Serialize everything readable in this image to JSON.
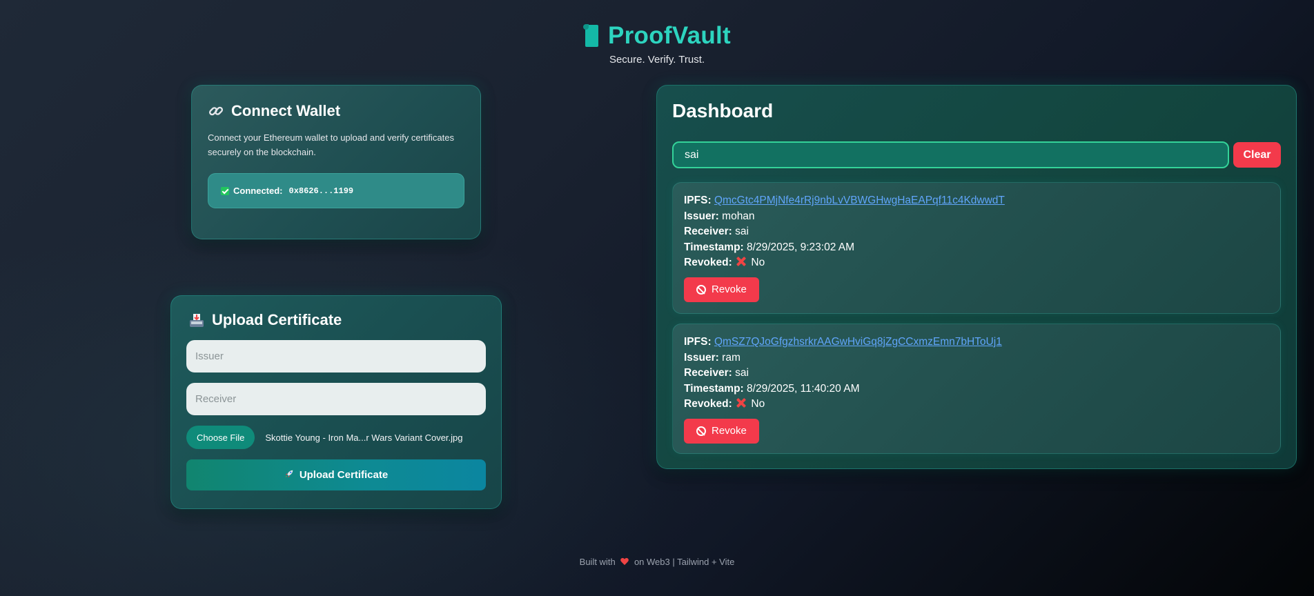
{
  "header": {
    "logo_icon": "scroll-icon",
    "title": "ProofVault",
    "tagline": "Secure. Verify. Trust."
  },
  "wallet": {
    "title_icon": "link-icon",
    "title": "Connect Wallet",
    "description": "Connect your Ethereum wallet to upload and verify certificates securely on the blockchain.",
    "status_icon": "check-icon",
    "connected_label": "Connected:",
    "address": "0x8626...1199"
  },
  "upload": {
    "title_icon": "inbox-tray-icon",
    "title": "Upload Certificate",
    "issuer_placeholder": "Issuer",
    "receiver_placeholder": "Receiver",
    "choose_file_label": "Choose File",
    "file_name": "Skottie Young - Iron Ma...r Wars Variant Cover.jpg",
    "button_icon": "rocket-icon",
    "button_label": "Upload Certificate"
  },
  "dashboard": {
    "title": "Dashboard",
    "search_value": "sai",
    "clear_label": "Clear",
    "labels": {
      "ipfs": "IPFS:",
      "issuer": "Issuer:",
      "receiver": "Receiver:",
      "timestamp": "Timestamp:",
      "revoked": "Revoked:"
    },
    "revoke_label": "Revoke",
    "certificates": [
      {
        "ipfs": "QmcGtc4PMjNfe4rRj9nbLvVBWGHwgHaEAPqf11c4KdwwdT",
        "issuer": "mohan",
        "receiver": "sai",
        "timestamp": "8/29/2025, 9:23:02 AM",
        "revoked": "No"
      },
      {
        "ipfs": "QmSZ7QJoGfgzhsrkrAAGwHviGq8jZgCCxmzEmn7bHToUj1",
        "issuer": "ram",
        "receiver": "sai",
        "timestamp": "8/29/2025, 11:40:20 AM",
        "revoked": "No"
      }
    ]
  },
  "footer": {
    "prefix": "Built with",
    "suffix": "on Web3 | Tailwind + Vite"
  },
  "colors": {
    "brand": "#2dd4bf",
    "danger": "#f33a4b",
    "link": "#60a5fa"
  }
}
